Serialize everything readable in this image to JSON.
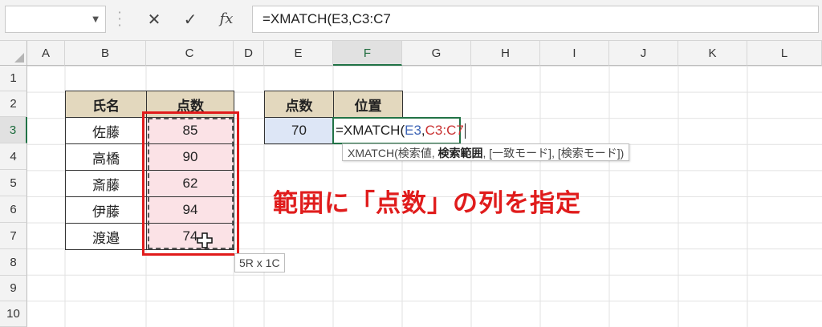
{
  "formula_bar": {
    "name_box_value": "",
    "cancel_glyph": "✕",
    "enter_glyph": "✓",
    "fx_label": "fx",
    "formula": "=XMATCH(E3,C3:C7"
  },
  "columns": [
    "A",
    "B",
    "C",
    "D",
    "E",
    "F",
    "G",
    "H",
    "I",
    "J",
    "K",
    "L"
  ],
  "rows": [
    "1",
    "2",
    "3",
    "4",
    "5",
    "6",
    "7",
    "8",
    "9",
    "10"
  ],
  "table1": {
    "header_name": "氏名",
    "header_score": "点数",
    "rows": [
      {
        "name": "佐藤",
        "score": "85"
      },
      {
        "name": "高橋",
        "score": "90"
      },
      {
        "name": "斎藤",
        "score": "62"
      },
      {
        "name": "伊藤",
        "score": "94"
      },
      {
        "name": "渡邉",
        "score": "74"
      }
    ]
  },
  "table2": {
    "header_score": "点数",
    "header_position": "位置",
    "score_value": "70",
    "edit_prefix": "=XMATCH(",
    "edit_ref1": "E3",
    "edit_comma": ",",
    "edit_ref2": "C3:C7"
  },
  "tooltip": {
    "prefix": "XMATCH(検索値, ",
    "bold_arg": "検索範囲",
    "suffix": ", [一致モード], [検索モード])"
  },
  "selection_size": "5R x 1C",
  "annotation": "範囲に「点数」の列を指定",
  "colors": {
    "accent_green": "#217346",
    "header_beige": "#e3d8be",
    "score_pink": "#fbe2e6",
    "value_blue": "#dde6f6",
    "annotation_red": "#e01c1c"
  }
}
